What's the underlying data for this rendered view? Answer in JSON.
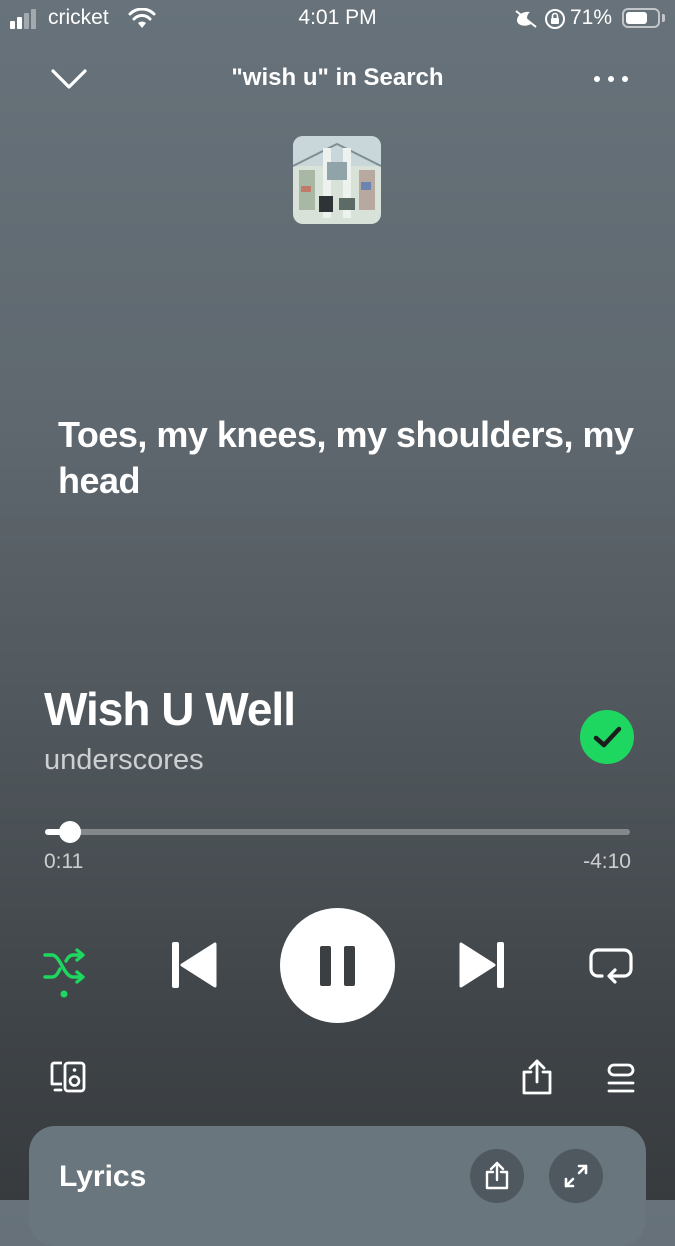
{
  "status_bar": {
    "carrier": "cricket",
    "time": "4:01 PM",
    "battery_percent": "71%",
    "battery_level": 0.71
  },
  "header": {
    "context_title": "\"wish u\" in Search"
  },
  "lyric_line": "Toes, my knees, my shoulders, my head",
  "track": {
    "title": "Wish U Well",
    "artist": "underscores",
    "liked": true
  },
  "progress": {
    "elapsed": "0:11",
    "remaining": "-4:10",
    "fraction": 0.043
  },
  "controls": {
    "shuffle_active": true,
    "playing": true
  },
  "lyrics_card": {
    "label": "Lyrics"
  },
  "colors": {
    "accent_green": "#1ed760",
    "background_top": "#67727a",
    "background_bottom": "#373b3e",
    "card": "#6a767e"
  }
}
